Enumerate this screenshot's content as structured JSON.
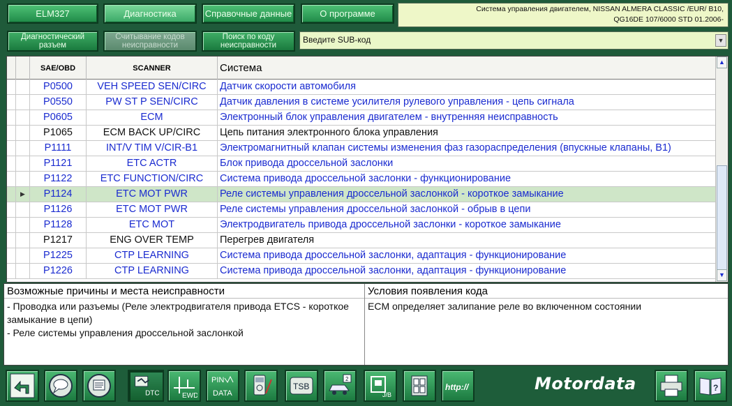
{
  "toolbar": {
    "elm327": "ELM327",
    "diagnostics": "Диагностика",
    "reference": "Справочные данные",
    "about": "О программе"
  },
  "vehicle_info": {
    "line1": "Система управления двигателем, NISSAN  ALMERA CLASSIC /EUR/  B10,",
    "line2": "QG16DE 107/6000  STD  01.2006-"
  },
  "subtoolbar": {
    "connector": "Диагностический разъем",
    "read_codes": "Считывание кодов неисправности",
    "search_code": "Поиск по коду неисправности"
  },
  "subcode_select": {
    "value": "Введите SUB-код"
  },
  "grid": {
    "headers": [
      "SAE/OBD",
      "SCANNER",
      "Система"
    ],
    "rows": [
      {
        "code": "P0500",
        "scanner": "VEH SPEED SEN/CIRC",
        "system": "Датчик скорости автомобиля",
        "color": "blue"
      },
      {
        "code": "P0550",
        "scanner": "PW ST P SEN/CIRC",
        "system": "Датчик давления в системе усилителя рулевого управления - цепь сигнала",
        "color": "blue"
      },
      {
        "code": "P0605",
        "scanner": "ECM",
        "system": "Электронный блок управления двигателем - внутренняя неисправность",
        "color": "blue"
      },
      {
        "code": "P1065",
        "scanner": "ECM BACK UP/CIRC",
        "system": "Цепь питания электронного блока управления",
        "color": "black"
      },
      {
        "code": "P1111",
        "scanner": "INT/V TIM V/CIR-B1",
        "system": "Электромагнитный клапан системы изменения фаз газораспределения (впускные клапаны, B1)",
        "color": "blue"
      },
      {
        "code": "P1121",
        "scanner": "ETC ACTR",
        "system": "Блок привода дроссельной заслонки",
        "color": "blue"
      },
      {
        "code": "P1122",
        "scanner": "ETC FUNCTION/CIRC",
        "system": "Система привода дроссельной заслонки - функционирование",
        "color": "blue"
      },
      {
        "code": "P1124",
        "scanner": "ETC MOT PWR",
        "system": "Реле системы управления дроссельной заслонкой - короткое замыкание",
        "color": "blue",
        "selected": true
      },
      {
        "code": "P1126",
        "scanner": "ETC MOT PWR",
        "system": "Реле системы управления дроссельной заслонкой - обрыв в цепи",
        "color": "blue"
      },
      {
        "code": "P1128",
        "scanner": "ETC MOT",
        "system": "Электродвигатель привода дроссельной заслонки - короткое замыкание",
        "color": "blue"
      },
      {
        "code": "P1217",
        "scanner": "ENG OVER TEMP",
        "system": "Перегрев двигателя",
        "color": "black"
      },
      {
        "code": "P1225",
        "scanner": "CTP LEARNING",
        "system": "Система привода дроссельной заслонки, адаптация - функционирование",
        "color": "blue"
      },
      {
        "code": "P1226",
        "scanner": "CTP LEARNING",
        "system": "Система привода дроссельной заслонки, адаптация - функционирование",
        "color": "blue"
      }
    ]
  },
  "details": {
    "causes_title": "Возможные причины и места неисправности",
    "causes_text_1": "- Проводка или разъемы (Реле электродвигателя привода ETCS - короткое замыкание в цепи)",
    "causes_text_2": "- Реле системы управления дроссельной заслонкой",
    "conditions_title": "Условия появления кода",
    "conditions_text": "ECM определяет залипание реле во включенном состоянии"
  },
  "bottom_toolbar": {
    "dtc_label": "DTC",
    "ewd_label": "EWD",
    "pin_label": "PIN",
    "data_label": "DATA",
    "tsb_label": "TSB",
    "jb_label": "J/B",
    "http_label": "http://",
    "brand": "Motordata"
  },
  "icons": [
    "back-icon",
    "chat-icon",
    "list-doc-icon",
    "dtc-icon",
    "ewd-icon",
    "pin-data-icon",
    "multimeter-icon",
    "tsb-icon",
    "car-repair-icon",
    "jb-icon",
    "fuse-grid-icon",
    "http-icon",
    "printer-icon",
    "help-book-icon"
  ],
  "colors": {
    "background": "#1f5a3a",
    "button": "#2fa05a",
    "selected_row": "#cfe6c8",
    "link_text": "#1a2bd0"
  }
}
